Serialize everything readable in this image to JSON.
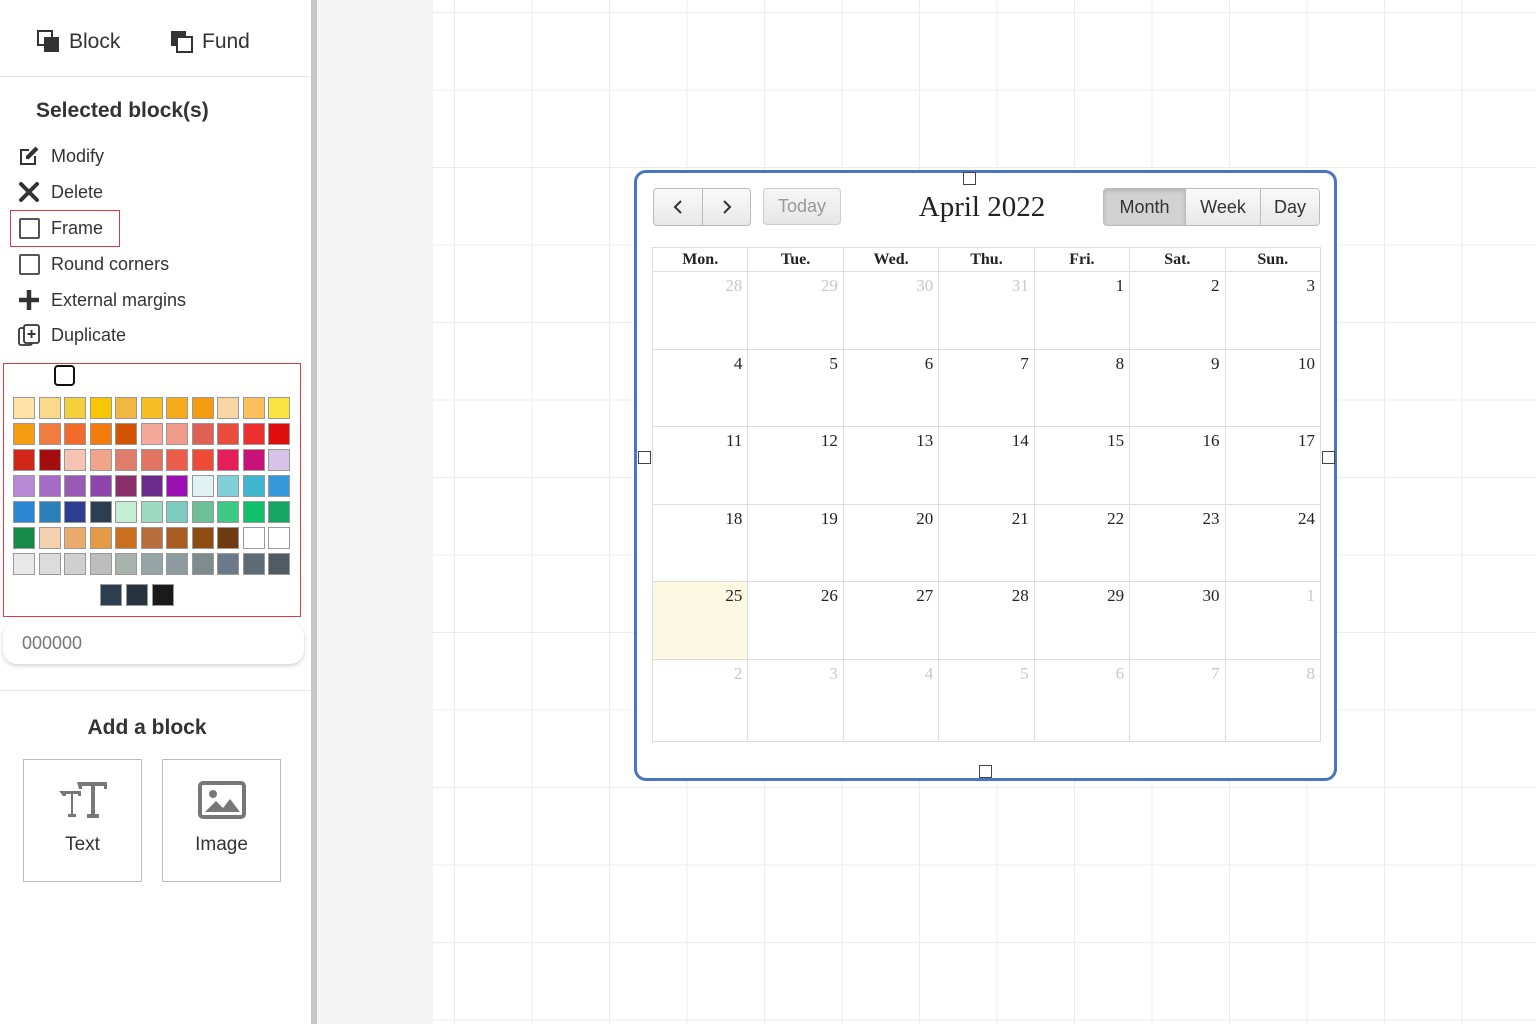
{
  "top_tabs": {
    "block": "Block",
    "fund": "Fund"
  },
  "selected": {
    "title": "Selected block(s)",
    "actions": {
      "modify": "Modify",
      "delete": "Delete",
      "frame": "Frame",
      "round_corners": "Round corners",
      "external_margins": "External margins",
      "duplicate": "Duplicate"
    }
  },
  "palette": {
    "colors": [
      "#fde3a7",
      "#fbd98b",
      "#f5d03b",
      "#f6c700",
      "#f1b840",
      "#f7bf23",
      "#f5ab1c",
      "#f39c12",
      "#fad6a5",
      "#fbc05c",
      "#fbe341",
      "#f39c12",
      "#f17c40",
      "#f26b2a",
      "#f47c0c",
      "#d35400",
      "#f5a99a",
      "#f19b8a",
      "#e06154",
      "#e74c3c",
      "#ec2f2f",
      "#e00b0b",
      "#d0271a",
      "#a30d0d",
      "#f7c4b3",
      "#f0a58a",
      "#dd7d6a",
      "#e27562",
      "#ec5d4b",
      "#ef4a33",
      "#e41f5c",
      "#c9127a",
      "#d7c3e8",
      "#b889d4",
      "#a56bc7",
      "#9b59b6",
      "#8e44ad",
      "#8b2f6b",
      "#6c2c8c",
      "#9b10b3",
      "#e1f2f4",
      "#7fd0d6",
      "#3fb5cf",
      "#3498db",
      "#2e86d1",
      "#2a7fb8",
      "#2c3e8f",
      "#2c3e50",
      "#c6eed7",
      "#9cdbc2",
      "#7ccbbf",
      "#6cc19b",
      "#3ec885",
      "#11c06b",
      "#16a661",
      "#168a48",
      "#f6d1b1",
      "#ebaa6e",
      "#e59b46",
      "#ca6f1e",
      "#b86e3d",
      "#a85c1f",
      "#8e4b12",
      "#6e3a12",
      "#ffffff",
      "#ffffff",
      "#e8e8e8",
      "#dcdcdc",
      "#cfcfcf",
      "#bdbdbd",
      "#a9b3ae",
      "#95a5a6",
      "#8f9a9e",
      "#7f8c8d",
      "#6c7a89",
      "#5f6b74",
      "#505b64"
    ],
    "dark": [
      "#2c3e50",
      "#27343f",
      "#1a1a1a"
    ],
    "hex_placeholder": "000000"
  },
  "add_block": {
    "title": "Add a block",
    "text": "Text",
    "image": "Image"
  },
  "calendar": {
    "prev_icon": "chevron-left-icon",
    "next_icon": "chevron-right-icon",
    "today": "Today",
    "title": "April 2022",
    "views": {
      "month": "Month",
      "week": "Week",
      "day": "Day"
    },
    "weekdays": [
      "Mon.",
      "Tue.",
      "Wed.",
      "Thu.",
      "Fri.",
      "Sat.",
      "Sun."
    ],
    "weeks": [
      [
        "28",
        "29",
        "30",
        "31",
        "1",
        "2",
        "3"
      ],
      [
        "4",
        "5",
        "6",
        "7",
        "8",
        "9",
        "10"
      ],
      [
        "11",
        "12",
        "13",
        "14",
        "15",
        "16",
        "17"
      ],
      [
        "18",
        "19",
        "20",
        "21",
        "22",
        "23",
        "24"
      ],
      [
        "25",
        "26",
        "27",
        "28",
        "29",
        "30",
        "1"
      ],
      [
        "2",
        "3",
        "4",
        "5",
        "6",
        "7",
        "8"
      ]
    ],
    "other_month": [
      [
        true,
        true,
        true,
        true,
        false,
        false,
        false
      ],
      [
        false,
        false,
        false,
        false,
        false,
        false,
        false
      ],
      [
        false,
        false,
        false,
        false,
        false,
        false,
        false
      ],
      [
        false,
        false,
        false,
        false,
        false,
        false,
        false
      ],
      [
        false,
        false,
        false,
        false,
        false,
        false,
        true
      ],
      [
        true,
        true,
        true,
        true,
        true,
        true,
        true
      ]
    ],
    "today_cell": [
      4,
      0
    ],
    "accent": "#4a74c4"
  }
}
